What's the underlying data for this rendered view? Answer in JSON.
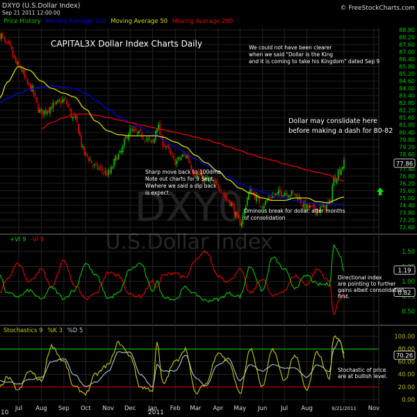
{
  "header": {
    "symbol": "DXY0 (U.S.Dollar Index)",
    "datetime": "Sep 21 2011 12:00:00",
    "logo": "© FreeStockCharts.com"
  },
  "legend": [
    {
      "label": "Price History",
      "color": "#00cc00"
    },
    {
      "label": "Moving Average 100",
      "color": "#0000ee"
    },
    {
      "label": "Moving Average 50",
      "color": "#dddd00"
    },
    {
      "label": "Moving Average 200",
      "color": "#ee0000"
    }
  ],
  "watermark": {
    "symbol": "DXY0",
    "name": "U.S.Dollar Index"
  },
  "annotations": {
    "title": "CAPITAL3X Dollar Index Charts Daily",
    "king": [
      "We could not have been clearer",
      "when we said \"Dollar is the King",
      "and it is coming to take his Kingdom\" dated Sep 9"
    ],
    "consolidate": [
      "Dollar may conslidate here",
      "before making a dash for 80-82"
    ],
    "sharp": [
      "Sharp move back to 100dma.",
      "Note out charts for 9 Sept.",
      "Wwhere we said a dip back",
      "is expect."
    ],
    "ominous": [
      "Ominous break for dollar. after months",
      "of consolidation"
    ],
    "directional": [
      "Directional index",
      "are pointing to further",
      "gains albeit consolidation",
      "first."
    ],
    "stochastic": [
      "Stochastic of price",
      "are at bullish level."
    ]
  },
  "x_axis": {
    "months": [
      {
        "label": "Jul",
        "date": "2010-07-01"
      },
      {
        "label": "Aug",
        "date": "2010-08-01"
      },
      {
        "label": "Sep",
        "date": "2010-09-01"
      },
      {
        "label": "Oct",
        "date": "2010-10-01"
      },
      {
        "label": "Nov",
        "date": "2010-11-01"
      },
      {
        "label": "Dec",
        "date": "2010-12-01"
      },
      {
        "label": "Jan",
        "date": "2011-01-01"
      },
      {
        "label": "Feb",
        "date": "2011-02-01"
      },
      {
        "label": "Mar",
        "date": "2011-03-01"
      },
      {
        "label": "Apr",
        "date": "2011-04-01"
      },
      {
        "label": "May",
        "date": "2011-05-01"
      },
      {
        "label": "Jun",
        "date": "2011-06-01"
      },
      {
        "label": "Jul",
        "date": "2011-07-01"
      },
      {
        "label": "Aug",
        "date": "2011-08-01"
      },
      {
        "label": "9/21/2011",
        "date": "2011-09-21"
      },
      {
        "label": "Nov",
        "date": "2011-11-01"
      }
    ],
    "year_left": "10",
    "year_mid": "2011"
  },
  "chart_data": [
    {
      "type": "candlestick",
      "title": "DXY0 (U.S.Dollar Index)",
      "ylim": [
        72.6,
        88.8
      ],
      "yticks": [
        "88.80",
        "88.20",
        "87.60",
        "87.00",
        "86.40",
        "85.80",
        "85.20",
        "84.60",
        "84.00",
        "83.40",
        "82.80",
        "82.20",
        "81.60",
        "81.00",
        "80.40",
        "79.80",
        "79.20",
        "78.60",
        "77.40",
        "76.80",
        "76.20",
        "75.60",
        "75.00",
        "74.40",
        "73.80",
        "73.20",
        "72.60"
      ],
      "last_value": "77.86",
      "grid": true,
      "dates": [
        "2010-06-05",
        "2010-06-15",
        "2010-07-01",
        "2010-07-15",
        "2010-08-01",
        "2010-08-15",
        "2010-09-01",
        "2010-09-15",
        "2010-10-01",
        "2010-10-15",
        "2010-11-01",
        "2010-11-15",
        "2010-12-01",
        "2010-12-15",
        "2011-01-01",
        "2011-01-07",
        "2011-01-15",
        "2011-02-01",
        "2011-02-15",
        "2011-03-01",
        "2011-03-15",
        "2011-04-01",
        "2011-04-15",
        "2011-05-01",
        "2011-05-15",
        "2011-06-01",
        "2011-06-15",
        "2011-07-01",
        "2011-07-15",
        "2011-08-01",
        "2011-08-15",
        "2011-09-01",
        "2011-09-07",
        "2011-09-15",
        "2011-09-21"
      ],
      "series": [
        {
          "name": "Price History",
          "color": "#00cc00",
          "values": [
            88.4,
            87.5,
            85.8,
            84.2,
            82,
            82.5,
            83,
            81.5,
            78.5,
            77.5,
            77,
            78.5,
            80.5,
            80.2,
            79.5,
            81,
            79.5,
            78,
            78.5,
            77,
            76.5,
            76,
            74.8,
            73,
            75.5,
            74.5,
            75.2,
            75.5,
            75.3,
            74.2,
            74,
            74.5,
            76.5,
            77.3,
            77.86
          ]
        },
        {
          "name": "Moving Average 100",
          "color": "#0000ee",
          "values": [
            82.8,
            83.2,
            83.6,
            83.9,
            84.1,
            84.2,
            84.1,
            84.0,
            83.6,
            83.0,
            82.3,
            81.7,
            81.2,
            80.8,
            80.3,
            80.1,
            79.8,
            79.2,
            78.7,
            78.2,
            77.7,
            77.2,
            76.7,
            76.2,
            75.8,
            75.5,
            75.2,
            75.0,
            74.8,
            74.6,
            74.5,
            74.5,
            74.5,
            74.5,
            74.5
          ]
        },
        {
          "name": "Moving Average 50",
          "color": "#dddd00",
          "values": [
            83.2,
            84.5,
            85.8,
            85.5,
            84.6,
            84,
            83.6,
            83.3,
            82.3,
            81.3,
            80.5,
            80.2,
            80.1,
            80.1,
            80.1,
            80.1,
            80.0,
            79.6,
            79.2,
            78.5,
            77.9,
            77.2,
            76.5,
            75.8,
            75.4,
            75.0,
            74.8,
            74.8,
            75.0,
            75.0,
            74.7,
            74.6,
            74.8,
            75.0,
            75.1
          ]
        },
        {
          "name": "Moving Average 200",
          "color": "#ee0000",
          "values": [
            null,
            null,
            null,
            null,
            80.7,
            81.2,
            81.6,
            81.9,
            81.9,
            81.8,
            81.6,
            81.4,
            81.2,
            81.0,
            80.8,
            80.7,
            80.6,
            80.4,
            80.2,
            80.0,
            79.8,
            79.5,
            79.2,
            78.9,
            78.6,
            78.3,
            78.1,
            77.8,
            77.6,
            77.3,
            77.1,
            76.9,
            76.7,
            76.5,
            76.4
          ]
        }
      ]
    },
    {
      "type": "line",
      "title": "+VI 9 -VI 9",
      "ylim": [
        0.4,
        1.65
      ],
      "yticks": [
        "1.50",
        "1.25",
        "1.00",
        "0.75",
        "0.50"
      ],
      "last_values": [
        "1.19",
        "0.82"
      ],
      "series": [
        {
          "name": "+VI 9",
          "color": "#00cc00",
          "values": [
            1.1,
            0.8,
            0.75,
            0.85,
            0.7,
            0.9,
            0.72,
            0.85,
            1.3,
            1.1,
            0.72,
            0.8,
            1.2,
            1.3,
            0.85,
            1.0,
            0.75,
            0.7,
            0.9,
            0.78,
            0.68,
            0.7,
            0.8,
            0.75,
            1.25,
            0.85,
            1.4,
            1.2,
            0.9,
            1.1,
            0.95,
            0.95,
            1.6,
            1.45,
            1.19
          ]
        },
        {
          "name": "-VI 9",
          "color": "#ee0000",
          "values": [
            0.82,
            1.05,
            1.3,
            1.0,
            1.2,
            0.9,
            1.35,
            0.95,
            0.7,
            0.8,
            1.15,
            1.1,
            0.78,
            0.75,
            1.0,
            0.9,
            1.1,
            1.15,
            1.05,
            1.35,
            1.5,
            1.1,
            1.0,
            1.2,
            0.8,
            1.05,
            0.75,
            0.85,
            1.1,
            0.95,
            1.2,
            1.0,
            0.45,
            0.7,
            0.82
          ]
        }
      ]
    },
    {
      "type": "line",
      "title": "Stochastics 9 %K 3 %D 5",
      "title_parts": [
        "Stochastics 9",
        "%K 3",
        "%D 5"
      ],
      "ylim": [
        0,
        100
      ],
      "yticks": [
        "100.00",
        "80.00",
        "60.00",
        "40.00",
        "20.00",
        "0.00"
      ],
      "last_value": "70.26",
      "levels": [
        {
          "value": 80,
          "color": "#00aa00"
        },
        {
          "value": 20,
          "color": "#aa0000"
        }
      ],
      "series": [
        {
          "name": "%K 3",
          "color": "#cccc00",
          "values": [
            20,
            35,
            15,
            45,
            30,
            85,
            60,
            20,
            10,
            40,
            55,
            90,
            70,
            20,
            15,
            90,
            25,
            60,
            80,
            10,
            25,
            75,
            60,
            10,
            80,
            20,
            80,
            30,
            70,
            15,
            75,
            35,
            100,
            95,
            68
          ]
        },
        {
          "name": "%D 5",
          "color": "#aaccdd",
          "values": [
            30,
            28,
            25,
            32,
            35,
            60,
            65,
            40,
            20,
            28,
            45,
            75,
            75,
            40,
            20,
            55,
            45,
            45,
            70,
            35,
            22,
            55,
            65,
            30,
            55,
            45,
            55,
            50,
            50,
            35,
            55,
            45,
            80,
            95,
            72
          ]
        }
      ]
    }
  ],
  "signal": {
    "icon": "up-arrow-icon",
    "color": "#00ee00"
  }
}
